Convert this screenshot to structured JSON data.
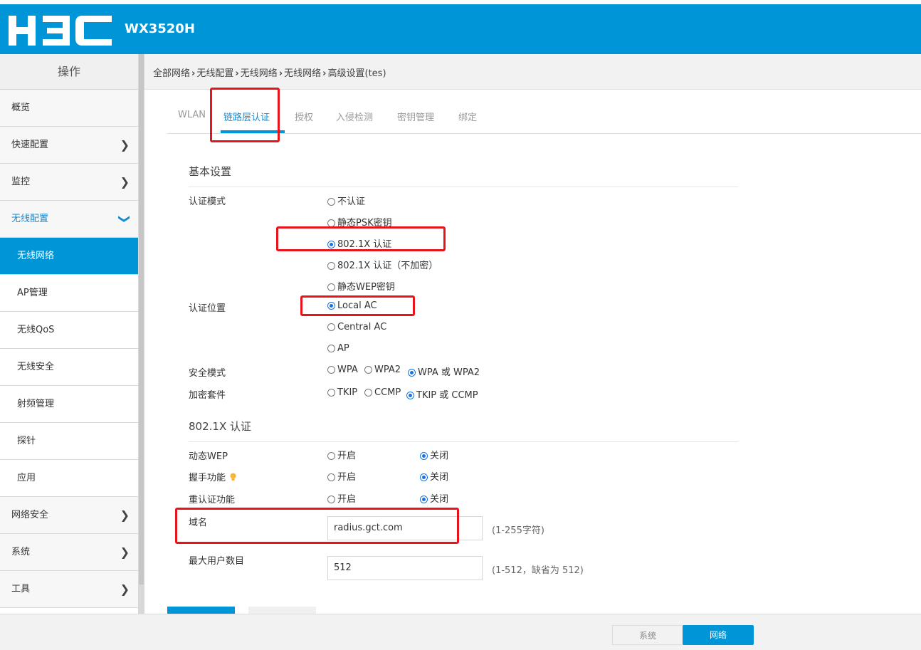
{
  "header": {
    "logo_text": "H3C",
    "model": "WX3520H"
  },
  "sidebar": {
    "title": "操作",
    "items": [
      {
        "label": "概览"
      },
      {
        "label": "快速配置"
      },
      {
        "label": "监控"
      },
      {
        "label": "无线配置"
      },
      {
        "label": "无线网络"
      },
      {
        "label": "AP管理"
      },
      {
        "label": "无线QoS"
      },
      {
        "label": "无线安全"
      },
      {
        "label": "射频管理"
      },
      {
        "label": "探针"
      },
      {
        "label": "应用"
      },
      {
        "label": "网络安全"
      },
      {
        "label": "系统"
      },
      {
        "label": "工具"
      }
    ]
  },
  "breadcrumb": [
    "全部网络",
    "无线配置",
    "无线网络",
    "无线网络",
    "高级设置(tes)"
  ],
  "tabs": [
    {
      "label": "WLAN"
    },
    {
      "label": "链路层认证",
      "active": true
    },
    {
      "label": "授权"
    },
    {
      "label": "入侵检测"
    },
    {
      "label": "密钥管理"
    },
    {
      "label": "绑定"
    }
  ],
  "basic": {
    "title": "基本设置",
    "auth_mode": {
      "label": "认证模式",
      "options": [
        "不认证",
        "静态PSK密钥",
        "802.1X 认证",
        "802.1X 认证（不加密）",
        "静态WEP密钥"
      ],
      "selected": "802.1X 认证"
    },
    "auth_location": {
      "label": "认证位置",
      "options": [
        "Local AC",
        "Central AC",
        "AP"
      ],
      "selected": "Local AC"
    },
    "security_mode": {
      "label": "安全模式",
      "options": [
        "WPA",
        "WPA2",
        "WPA 或 WPA2"
      ],
      "selected": "WPA 或 WPA2"
    },
    "cipher_suite": {
      "label": "加密套件",
      "options": [
        "TKIP",
        "CCMP",
        "TKIP 或 CCMP"
      ],
      "selected": "TKIP 或 CCMP"
    }
  },
  "dot1x": {
    "title": "802.1X 认证",
    "dynamic_wep": {
      "label": "动态WEP",
      "on": "开启",
      "off": "关闭",
      "selected": "关闭"
    },
    "handshake": {
      "label": "握手功能",
      "on": "开启",
      "off": "关闭",
      "selected": "关闭"
    },
    "reauth": {
      "label": "重认证功能",
      "on": "开启",
      "off": "关闭",
      "selected": "关闭"
    },
    "domain": {
      "label": "域名",
      "value": "radius.gct.com",
      "hint": "(1-255字符)"
    },
    "max_users": {
      "label": "最大用户数目",
      "value": "512",
      "hint": "(1-512，缺省为 512)"
    }
  },
  "footer": {
    "system": "系统",
    "network": "网络",
    "active": "网络"
  },
  "colors": {
    "brand": "#0095d6",
    "highlight": "#e8141c"
  }
}
